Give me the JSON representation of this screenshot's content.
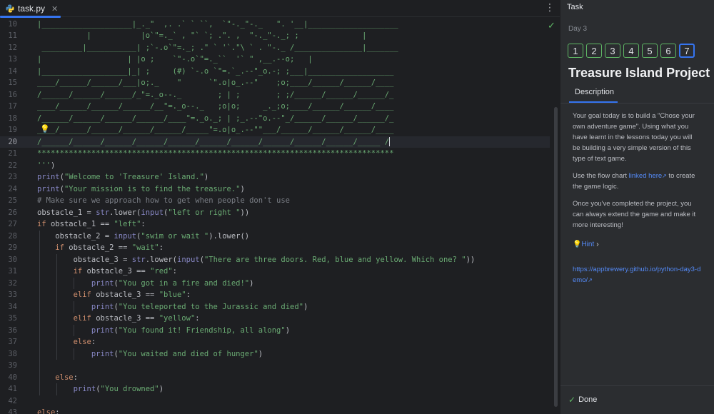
{
  "editor": {
    "tab": {
      "filename": "task.py",
      "close": "✕"
    },
    "menu_icon": "⋮",
    "status_icon": "check-icon",
    "current_line": "20",
    "line_numbers": [
      "10",
      "11",
      "12",
      "13",
      "14",
      "15",
      "16",
      "17",
      "18",
      "19",
      "20",
      "21",
      "22",
      "23",
      "24",
      "25",
      "26",
      "27",
      "28",
      "29",
      "30",
      "31",
      "32",
      "33",
      "34",
      "35",
      "36",
      "37",
      "38",
      "39",
      "40",
      "41",
      "42",
      "43"
    ],
    "lines": [
      [
        {
          "t": "s",
          "v": "|____________________|_._\"  ,. .` ` ``,  `\"-._\"-._   \". '__|____________________"
        }
      ],
      [
        {
          "t": "s",
          "v": "           |           |o`\"=._` , \"` `; .\". ,  \"-._\"-._; ;              |"
        }
      ],
      [
        {
          "t": "s",
          "v": " _________|___________| ;`-.o`\"=._; .\" ` '`.\"\\ ` . \"-._ /_______________|_______"
        }
      ],
      [
        {
          "t": "s",
          "v": "|                   | |o ;    `\"-.o`\"=._``  '` \" ,__.--o;   |"
        }
      ],
      [
        {
          "t": "s",
          "v": "|___________________|_| ;     (#) `-.o `\"=.`_.--\"_o.-; ;___|___________________"
        }
      ],
      [
        {
          "t": "s",
          "v": "____/______/______/___|o;._    \"      `\".o|o_.--\"    ;o;____/______/______/____"
        }
      ],
      [
        {
          "t": "s",
          "v": "/______/______/______/_\"=._o--._        ; | ;        ; ;/______/______/______/_"
        }
      ],
      [
        {
          "t": "s",
          "v": "____/______/______/______/__\"=._o--._   ;o|o;     _._;o;____/______/______/____"
        }
      ],
      [
        {
          "t": "s",
          "v": "/______/______/______/______/____\"=._o._; | ;_.--\"o.--\"_/______/______/______/_"
        }
      ],
      [
        {
          "t": "s",
          "v": "____/______/______/______/______/_____\"=.o|o_.--\"\"___/______/______/______/____"
        }
      ],
      [
        {
          "t": "s",
          "v": "/______/______/______/______/______/______/______/______/______/______/_____ /"
        },
        {
          "t": "caret",
          "v": ""
        }
      ],
      [
        {
          "t": "s",
          "v": "*******************************************************************************"
        }
      ],
      [
        {
          "t": "s",
          "v": "'''"
        },
        {
          "t": "p",
          "v": ")"
        }
      ],
      [
        {
          "t": "b",
          "v": "print"
        },
        {
          "t": "p",
          "v": "("
        },
        {
          "t": "s",
          "v": "\"Welcome to 'Treasure' Island.\""
        },
        {
          "t": "p",
          "v": ")"
        }
      ],
      [
        {
          "t": "b",
          "v": "print"
        },
        {
          "t": "p",
          "v": "("
        },
        {
          "t": "s",
          "v": "\"Your mission is to find the treasure.\""
        },
        {
          "t": "p",
          "v": ")"
        }
      ],
      [
        {
          "t": "c",
          "v": "# Make sure we approach how to get when people don't use"
        }
      ],
      [
        {
          "t": "p",
          "v": "obstacle_1 = "
        },
        {
          "t": "b",
          "v": "str"
        },
        {
          "t": "p",
          "v": ".lower("
        },
        {
          "t": "b",
          "v": "input"
        },
        {
          "t": "p",
          "v": "("
        },
        {
          "t": "s",
          "v": "\"left or right \""
        },
        {
          "t": "p",
          "v": "))"
        }
      ],
      [
        {
          "t": "k",
          "v": "if"
        },
        {
          "t": "p",
          "v": " obstacle_1 == "
        },
        {
          "t": "s",
          "v": "\"left\""
        },
        {
          "t": "p",
          "v": ":"
        }
      ],
      [
        {
          "t": "p",
          "v": "    obstacle_2 = "
        },
        {
          "t": "b",
          "v": "input"
        },
        {
          "t": "p",
          "v": "("
        },
        {
          "t": "s",
          "v": "\"swim or wait \""
        },
        {
          "t": "p",
          "v": ").lower()"
        }
      ],
      [
        {
          "t": "p",
          "v": "    "
        },
        {
          "t": "k",
          "v": "if"
        },
        {
          "t": "p",
          "v": " obstacle_2 == "
        },
        {
          "t": "s",
          "v": "\"wait\""
        },
        {
          "t": "p",
          "v": ":"
        }
      ],
      [
        {
          "t": "p",
          "v": "        obstacle_3 = "
        },
        {
          "t": "b",
          "v": "str"
        },
        {
          "t": "p",
          "v": ".lower("
        },
        {
          "t": "b",
          "v": "input"
        },
        {
          "t": "p",
          "v": "("
        },
        {
          "t": "s",
          "v": "\"There are three doors. Red, blue and yellow. Which one? \""
        },
        {
          "t": "p",
          "v": "))"
        }
      ],
      [
        {
          "t": "p",
          "v": "        "
        },
        {
          "t": "k",
          "v": "if"
        },
        {
          "t": "p",
          "v": " obstacle_3 == "
        },
        {
          "t": "s",
          "v": "\"red\""
        },
        {
          "t": "p",
          "v": ":"
        }
      ],
      [
        {
          "t": "p",
          "v": "            "
        },
        {
          "t": "b",
          "v": "print"
        },
        {
          "t": "p",
          "v": "("
        },
        {
          "t": "s",
          "v": "\"You got in a fire and died!\""
        },
        {
          "t": "p",
          "v": ")"
        }
      ],
      [
        {
          "t": "p",
          "v": "        "
        },
        {
          "t": "k",
          "v": "elif"
        },
        {
          "t": "p",
          "v": " obstacle_3 == "
        },
        {
          "t": "s",
          "v": "\"blue\""
        },
        {
          "t": "p",
          "v": ":"
        }
      ],
      [
        {
          "t": "p",
          "v": "            "
        },
        {
          "t": "b",
          "v": "print"
        },
        {
          "t": "p",
          "v": "("
        },
        {
          "t": "s",
          "v": "\"You teleported to the Jurassic and died\""
        },
        {
          "t": "p",
          "v": ")"
        }
      ],
      [
        {
          "t": "p",
          "v": "        "
        },
        {
          "t": "k",
          "v": "elif"
        },
        {
          "t": "p",
          "v": " obstacle_3 == "
        },
        {
          "t": "s",
          "v": "\"yellow\""
        },
        {
          "t": "p",
          "v": ":"
        }
      ],
      [
        {
          "t": "p",
          "v": "            "
        },
        {
          "t": "b",
          "v": "print"
        },
        {
          "t": "p",
          "v": "("
        },
        {
          "t": "s",
          "v": "\"You found it! Friendship, all along\""
        },
        {
          "t": "p",
          "v": ")"
        }
      ],
      [
        {
          "t": "p",
          "v": "        "
        },
        {
          "t": "k",
          "v": "else"
        },
        {
          "t": "p",
          "v": ":"
        }
      ],
      [
        {
          "t": "p",
          "v": "            "
        },
        {
          "t": "b",
          "v": "print"
        },
        {
          "t": "p",
          "v": "("
        },
        {
          "t": "s",
          "v": "\"You waited and died of hunger\""
        },
        {
          "t": "p",
          "v": ")"
        }
      ],
      [],
      [
        {
          "t": "p",
          "v": "    "
        },
        {
          "t": "k",
          "v": "else"
        },
        {
          "t": "p",
          "v": ":"
        }
      ],
      [
        {
          "t": "p",
          "v": "        "
        },
        {
          "t": "b",
          "v": "print"
        },
        {
          "t": "p",
          "v": "("
        },
        {
          "t": "s",
          "v": "\"You drowned\""
        },
        {
          "t": "p",
          "v": ")"
        }
      ],
      [],
      [
        {
          "t": "k",
          "v": "else"
        },
        {
          "t": "p",
          "v": ":"
        }
      ]
    ]
  },
  "panel": {
    "header": "Task",
    "day": "Day 3",
    "steps": [
      "1",
      "2",
      "3",
      "4",
      "5",
      "6",
      "7"
    ],
    "current_step": "7",
    "title": "Treasure Island Project",
    "tab": "Description",
    "para1": "Your goal today is to build a \"Chose your own adventure game\". Using what you have learnt in the lessons today you will be building a very simple version of this type of text game.",
    "para2_pre": "Use the flow chart ",
    "para2_link": "linked here",
    "para2_post": " to create the game logic.",
    "para3": "Once you've completed the project, you can always extend the game and make it more interesting!",
    "hint": "Hint",
    "url": "https://appbrewery.github.io/python-day3-demo/",
    "done": "Done"
  },
  "colors": {
    "accent": "#3574f0",
    "success": "#5fb865",
    "link": "#548af7",
    "string": "#6aab73",
    "keyword": "#cf8e6d",
    "builtin": "#8888c6",
    "comment": "#7a7e85"
  }
}
